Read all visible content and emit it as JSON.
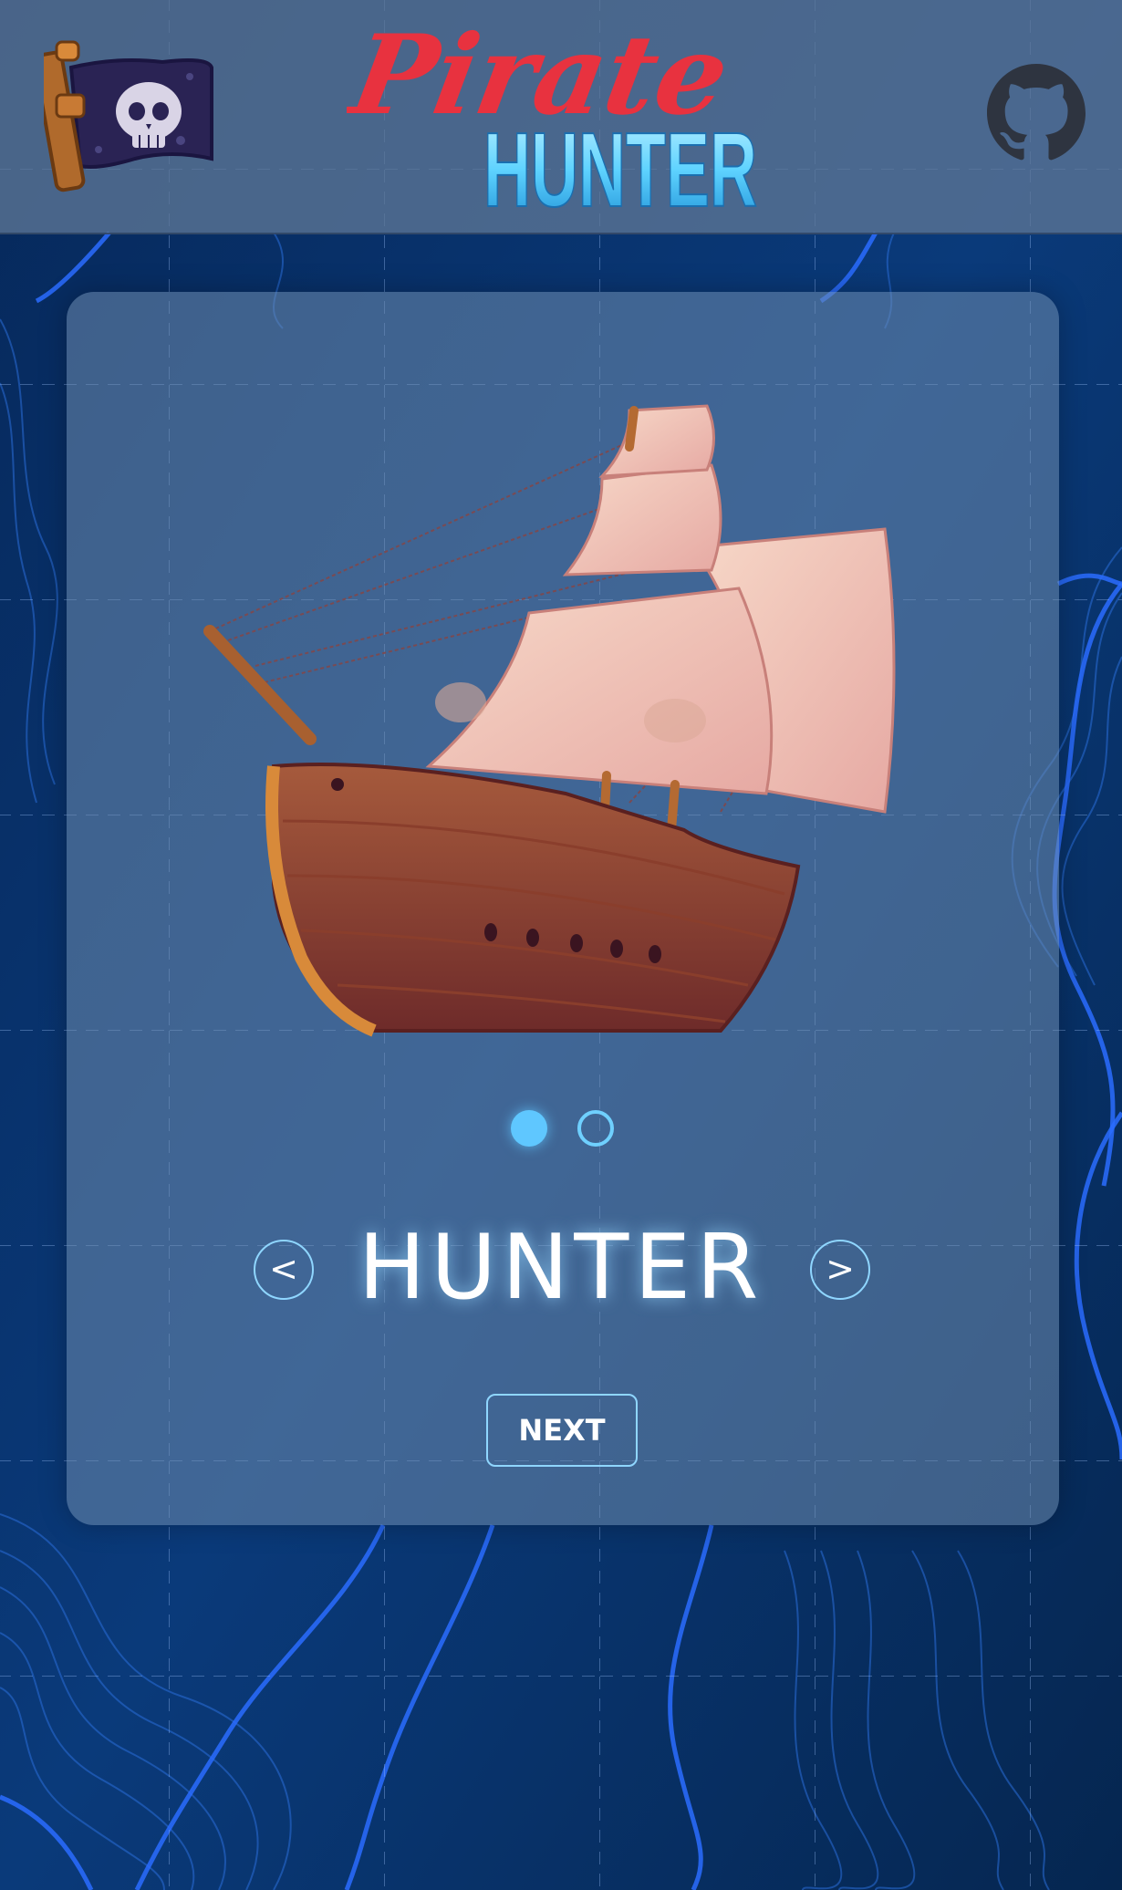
{
  "header": {
    "logo_line1": "Pirate",
    "logo_line2": "HUNTER",
    "menu_icon": "pirate-flag-icon",
    "github_icon": "github-icon"
  },
  "carousel": {
    "image": "pirate-ship",
    "slide_count": 2,
    "active_slide": 1,
    "prev_label": "<",
    "next_label": ">",
    "mode_name": "HUNTER"
  },
  "actions": {
    "next_button": "NEXT"
  },
  "colors": {
    "accent": "#5fc7ff",
    "logo_red": "#e8323f",
    "logo_cyan": "#5fd3ff",
    "background": "#062a5c"
  }
}
